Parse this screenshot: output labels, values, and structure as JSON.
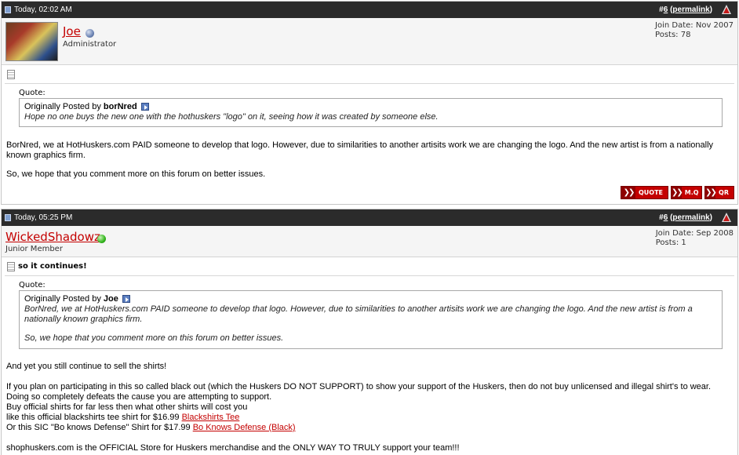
{
  "posts": [
    {
      "date": "Today, 02:02 AM",
      "post_number_prefix": "#",
      "post_number": "6",
      "permalink_label": "permalink",
      "username": "Joe",
      "user_title": "Administrator",
      "status": "offline",
      "join_date": "Join Date: Nov 2007",
      "post_count": "Posts: 78",
      "title": "",
      "quote_label": "Quote:",
      "quote_by_prefix": "Originally Posted by",
      "quote_author": "borNred",
      "quote_lines": [
        "Hope no one buys the new one with the hothuskers \"logo\" on it, seeing how it was created by someone else."
      ],
      "message": [
        "BorNred, we at HotHuskers.com PAID someone to develop that logo. However, due to similarities to another artisits work we are changing the logo. And the new artist is from a nationally known graphics firm.",
        "So, we hope that you comment more on this forum on better issues."
      ],
      "buttons": [
        {
          "label": "QUOTE"
        },
        {
          "label": "M.Q"
        },
        {
          "label": "QR"
        }
      ]
    },
    {
      "date": "Today, 05:25 PM",
      "post_number_prefix": "#",
      "post_number": "6",
      "permalink_label": "permalink",
      "username": "WickedShadowz",
      "user_title": "Junior Member",
      "status": "online",
      "join_date": "Join Date: Sep 2008",
      "post_count": "Posts: 1",
      "title": "so it continues!",
      "quote_label": "Quote:",
      "quote_by_prefix": "Originally Posted by",
      "quote_author": "Joe",
      "quote_lines": [
        "BorNred, we at HotHuskers.com PAID someone to develop that logo. However, due to similarities to another artisits work we are changing the logo. And the new artist is from a nationally known graphics firm.",
        "So, we hope that you comment more on this forum on better issues."
      ],
      "message": [
        "And yet you still continue to sell the shirts!",
        "If you plan on participating in this so called black out (which the Huskers DO NOT SUPPORT) to show your support of the Huskers, then do not buy unlicensed and illegal shirt's to wear.",
        "Doing so completely defeats the cause you are attempting to support.",
        "Buy official shirts for far less then what other shirts will cost you",
        "like this official blackshirts tee shirt for $16.99",
        "Blackshirts Tee",
        "Or this SIC \"Bo knows Defense\" Shirt for $17.99",
        "Bo Knows Defense (Black)",
        "shophuskers.com is the OFFICIAL Store for Huskers merchandise and the ONLY WAY TO TRULY support your team!!!"
      ]
    }
  ],
  "colors": {
    "header_bar": "#2b2b2b",
    "username_red": "#c40000",
    "button_red": "#c40000",
    "online_green": "#32b51c",
    "offline_blue": "#6c84b4"
  }
}
